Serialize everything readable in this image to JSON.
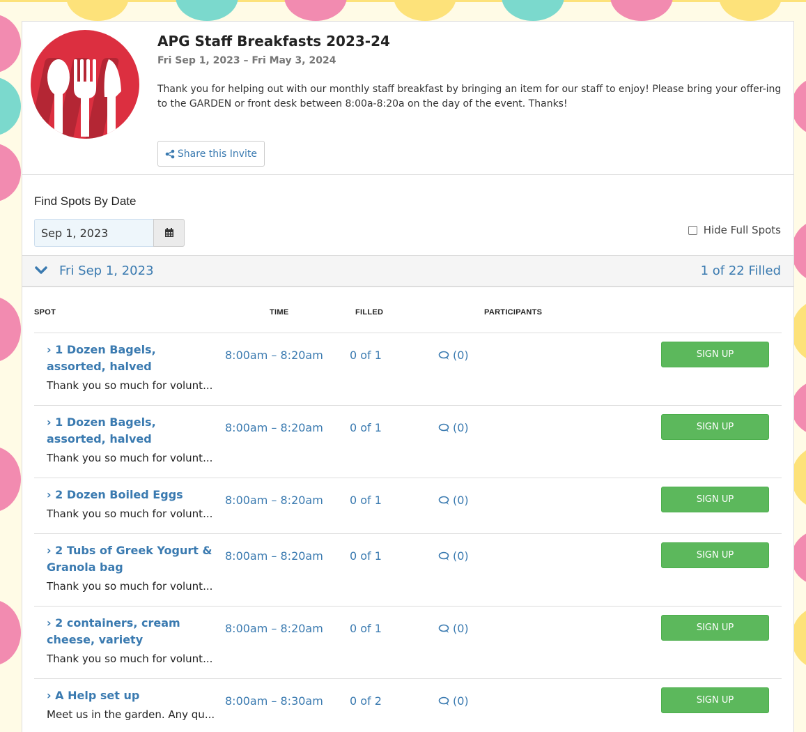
{
  "colors": {
    "accent": "#3a7ab0",
    "signup": "#5cb85c",
    "logo_bg": "#dc2f40"
  },
  "event": {
    "title": "APG Staff Breakfasts 2023-24",
    "dates": "Fri Sep 1, 2023 – Fri May 3, 2024",
    "description": "Thank you for helping out with our monthly staff breakfast by bringing an item for our staff to enjoy! Please bring your offer-ing to the GARDEN or front desk between 8:00a-8:20a on the day of the event. Thanks!",
    "share_label": "Share this Invite",
    "logo_icon": "fork-knife-spoon-icon"
  },
  "filters": {
    "find_label": "Find Spots By Date",
    "date_value": "Sep 1, 2023",
    "hide_full_label": "Hide Full Spots"
  },
  "day": {
    "label": "Fri Sep 1, 2023",
    "filled": "1 of 22 Filled"
  },
  "columns": {
    "spot": "SPOT",
    "time": "TIME",
    "filled": "FILLED",
    "participants": "PARTICIPANTS"
  },
  "spots": [
    {
      "name": "1 Dozen Bagels, assorted, halved",
      "desc": "Thank you so much for volunt...",
      "time": "8:00am – 8:20am",
      "filled": "0 of 1",
      "comments": "(0)",
      "action": "SIGN UP"
    },
    {
      "name": "1 Dozen Bagels, assorted, halved",
      "desc": "Thank you so much for volunt...",
      "time": "8:00am – 8:20am",
      "filled": "0 of 1",
      "comments": "(0)",
      "action": "SIGN UP"
    },
    {
      "name": "2 Dozen Boiled Eggs",
      "desc": "Thank you so much for volunt...",
      "time": "8:00am – 8:20am",
      "filled": "0 of 1",
      "comments": "(0)",
      "action": "SIGN UP"
    },
    {
      "name": "2 Tubs of Greek Yogurt & Granola bag",
      "desc": "Thank you so much for volunt...",
      "time": "8:00am – 8:20am",
      "filled": "0 of 1",
      "comments": "(0)",
      "action": "SIGN UP"
    },
    {
      "name": "2 containers, cream cheese, variety",
      "desc": "Thank you so much for volunt...",
      "time": "8:00am – 8:20am",
      "filled": "0 of 1",
      "comments": "(0)",
      "action": "SIGN UP"
    },
    {
      "name": "A Help set up",
      "desc": "Meet us in the garden. Any qu...",
      "time": "8:00am – 8:30am",
      "filled": "0 of 2",
      "comments": "(0)",
      "action": "SIGN UP"
    }
  ]
}
